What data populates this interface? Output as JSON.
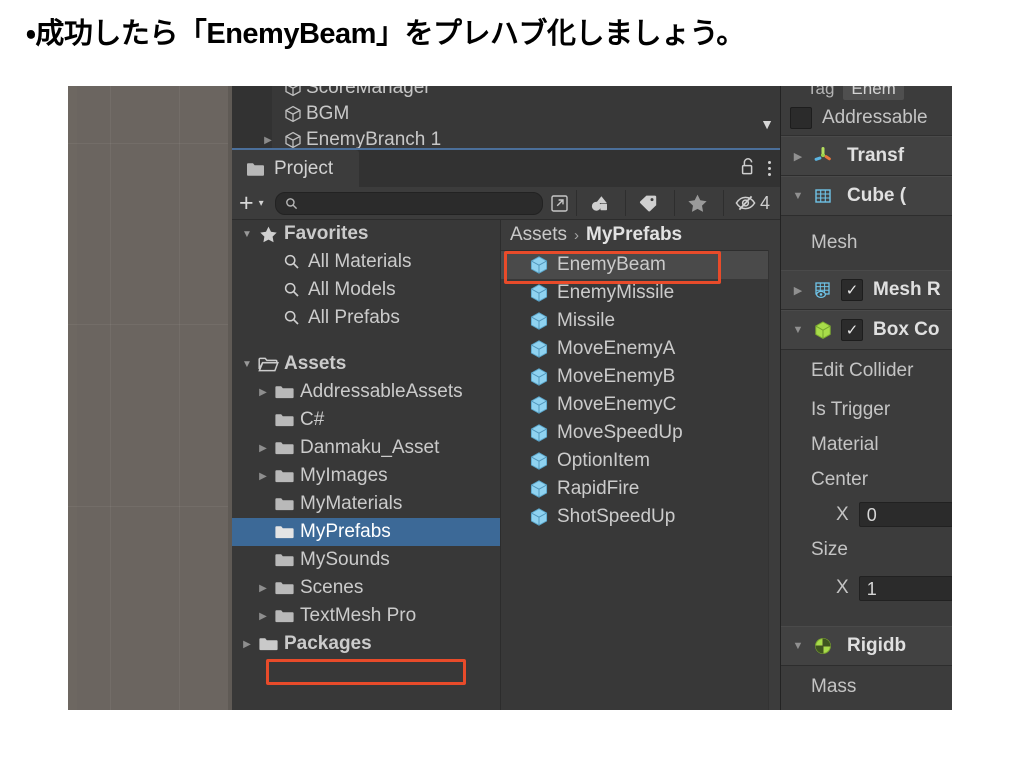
{
  "slide": {
    "heading": "・成功したら「EnemyBeam」をプレハブ化しましょう。"
  },
  "colors": {
    "accent_red": "#e84b2a",
    "selection_blue": "#3c6997",
    "panel_bg": "#383838",
    "scene_bg": "#6b6560",
    "tab_active_border": "#4b6f9a"
  },
  "hierarchy": {
    "rows": [
      {
        "label": "ScoreManager",
        "icon": "gameobject-icon",
        "twisty": ""
      },
      {
        "label": "BGM",
        "icon": "gameobject-icon",
        "twisty": ""
      },
      {
        "label": "EnemyBranch 1",
        "icon": "gameobject-icon",
        "twisty": "▶"
      }
    ],
    "scroll_arrow": "▼"
  },
  "project": {
    "tab_label": "Project",
    "tab_icon": "folder-icon",
    "lock_icon": "lock-open-icon",
    "menu_icon": "kebab-menu-icon",
    "toolbar": {
      "create_label": "+",
      "create_caret": "▾",
      "search_value": "",
      "search_placeholder": "",
      "search_icon": "search-icon",
      "open_in_new_icon": "open-in-new-icon",
      "filter_type_icon": "filter-by-type-icon",
      "filter_label_icon": "filter-by-label-icon",
      "favorites_icon": "star-icon",
      "hidden_icon": "eye-hidden-icon",
      "hidden_count": "4"
    },
    "tree": [
      {
        "label": "Favorites",
        "twisty": "▼",
        "icon": "star-icon",
        "indent": 0,
        "bold": true,
        "selected": false
      },
      {
        "label": "All Materials",
        "twisty": "",
        "icon": "search-icon",
        "indent": 1,
        "bold": false,
        "selected": false
      },
      {
        "label": "All Models",
        "twisty": "",
        "icon": "search-icon",
        "indent": 1,
        "bold": false,
        "selected": false
      },
      {
        "label": "All Prefabs",
        "twisty": "",
        "icon": "search-icon",
        "indent": 1,
        "bold": false,
        "selected": false
      },
      {
        "label": "Assets",
        "twisty": "▼",
        "icon": "folder-open-icon",
        "indent": 0,
        "bold": true,
        "selected": false
      },
      {
        "label": "AddressableAssets",
        "twisty": "▶",
        "icon": "folder-icon",
        "indent": 1,
        "bold": false,
        "selected": false
      },
      {
        "label": "C#",
        "twisty": "",
        "icon": "folder-icon",
        "indent": 1,
        "bold": false,
        "selected": false
      },
      {
        "label": "Danmaku_Asset",
        "twisty": "▶",
        "icon": "folder-icon",
        "indent": 1,
        "bold": false,
        "selected": false
      },
      {
        "label": "MyImages",
        "twisty": "▶",
        "icon": "folder-icon",
        "indent": 1,
        "bold": false,
        "selected": false
      },
      {
        "label": "MyMaterials",
        "twisty": "",
        "icon": "folder-icon",
        "indent": 1,
        "bold": false,
        "selected": false
      },
      {
        "label": "MyPrefabs",
        "twisty": "",
        "icon": "folder-icon",
        "indent": 1,
        "bold": false,
        "selected": true
      },
      {
        "label": "MySounds",
        "twisty": "",
        "icon": "folder-icon",
        "indent": 1,
        "bold": false,
        "selected": false
      },
      {
        "label": "Scenes",
        "twisty": "▶",
        "icon": "folder-icon",
        "indent": 1,
        "bold": false,
        "selected": false
      },
      {
        "label": "TextMesh Pro",
        "twisty": "▶",
        "icon": "folder-icon",
        "indent": 1,
        "bold": false,
        "selected": false
      },
      {
        "label": "Packages",
        "twisty": "▶",
        "icon": "folder-icon",
        "indent": 0,
        "bold": true,
        "selected": false
      }
    ],
    "breadcrumb": {
      "root": "Assets",
      "separator": "›",
      "current": "MyPrefabs"
    },
    "assets": [
      {
        "label": "EnemyBeam",
        "icon": "prefab-icon",
        "selected": true
      },
      {
        "label": "EnemyMissile",
        "icon": "prefab-icon",
        "selected": false
      },
      {
        "label": "Missile",
        "icon": "prefab-icon",
        "selected": false
      },
      {
        "label": "MoveEnemyA",
        "icon": "prefab-icon",
        "selected": false
      },
      {
        "label": "MoveEnemyB",
        "icon": "prefab-icon",
        "selected": false
      },
      {
        "label": "MoveEnemyC",
        "icon": "prefab-icon",
        "selected": false
      },
      {
        "label": "MoveSpeedUp",
        "icon": "prefab-icon",
        "selected": false
      },
      {
        "label": "OptionItem",
        "icon": "prefab-icon",
        "selected": false
      },
      {
        "label": "RapidFire",
        "icon": "prefab-icon",
        "selected": false
      },
      {
        "label": "ShotSpeedUp",
        "icon": "prefab-icon",
        "selected": false
      }
    ]
  },
  "inspector": {
    "tag_label": "Tag",
    "tag_value": "Enem",
    "addressable_label": "Addressable",
    "addressable_checked": false,
    "components": [
      {
        "title": "Transf",
        "foldout": "▶",
        "icon": "transform-icon",
        "has_enable_checkbox": false
      },
      {
        "title": "Cube (",
        "foldout": "▼",
        "icon": "mesh-filter-icon",
        "has_enable_checkbox": false
      },
      {
        "title": "Mesh R",
        "foldout": "▶",
        "icon": "mesh-renderer-icon",
        "has_enable_checkbox": true
      },
      {
        "title": "Box Co",
        "foldout": "▼",
        "icon": "box-collider-icon",
        "has_enable_checkbox": true
      },
      {
        "title": "Rigidb",
        "foldout": "▼",
        "icon": "rigidbody-icon",
        "has_enable_checkbox": false
      }
    ],
    "mesh_label": "Mesh",
    "edit_collider_label": "Edit Collider",
    "is_trigger_label": "Is Trigger",
    "material_label": "Material",
    "center_label": "Center",
    "center_x_axis": "X",
    "center_x_value": "0",
    "size_label": "Size",
    "size_x_axis": "X",
    "size_x_value": "1",
    "mass_label": "Mass"
  },
  "annotations": [
    {
      "name": "enemybeam-highlight",
      "target": "EnemyBeam"
    },
    {
      "name": "myprefabs-highlight",
      "target": "MyPrefabs"
    }
  ]
}
